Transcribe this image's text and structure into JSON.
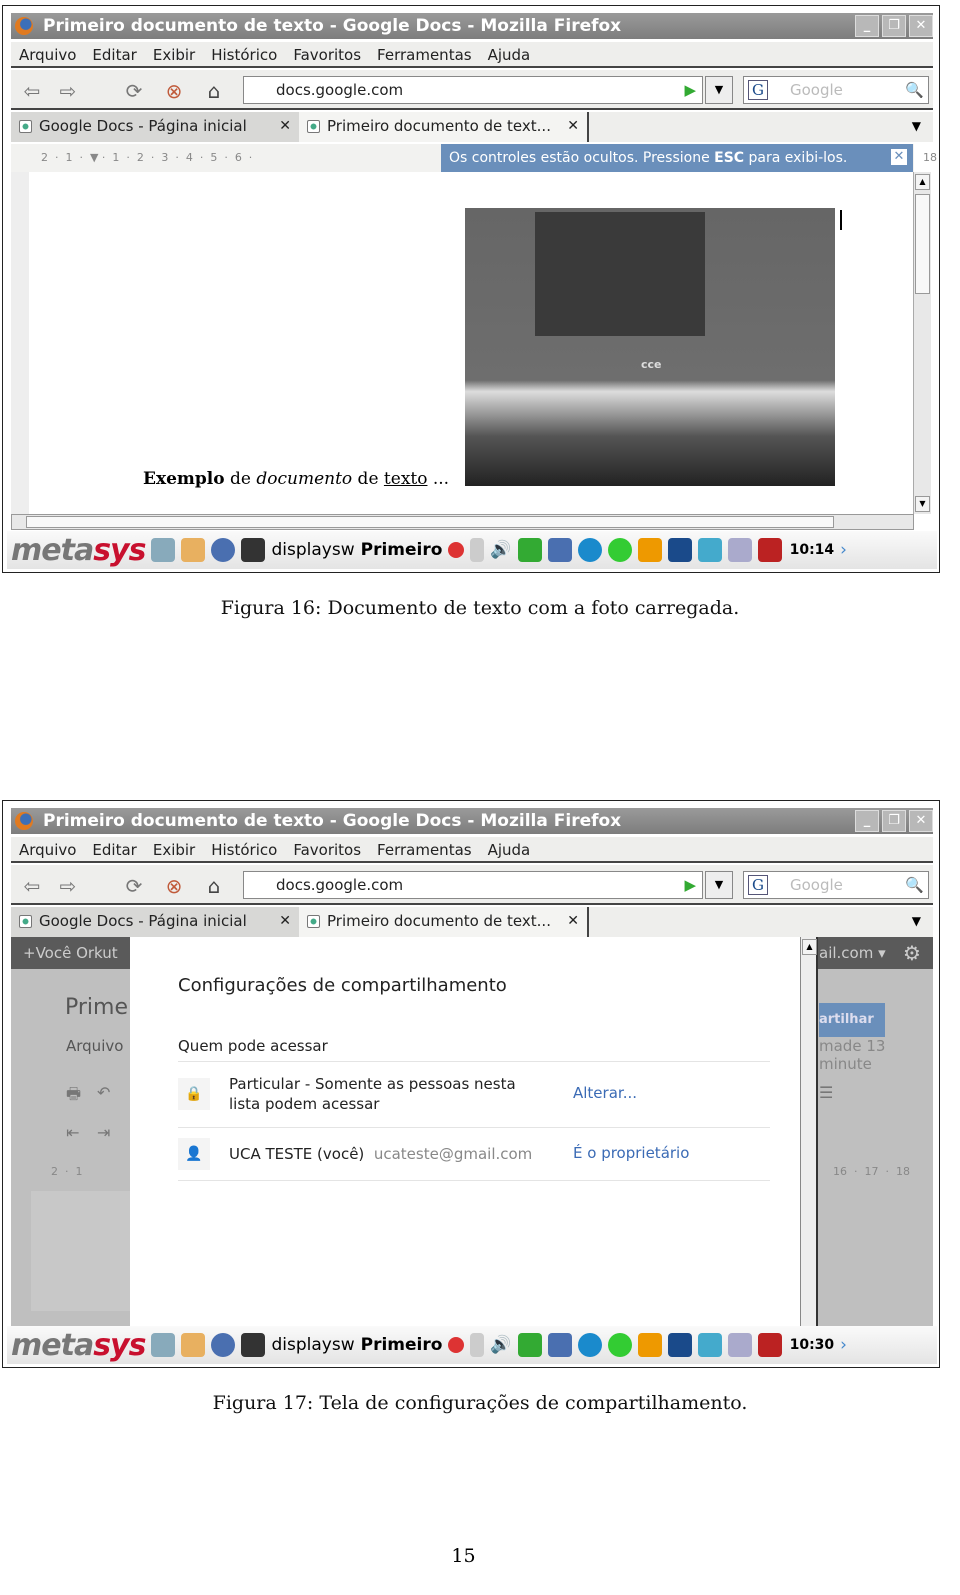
{
  "browser": {
    "window_title": "Primeiro documento de texto - Google Docs - Mozilla Firefox",
    "menu": [
      "Arquivo",
      "Editar",
      "Exibir",
      "Histórico",
      "Favoritos",
      "Ferramentas",
      "Ajuda"
    ],
    "url": "docs.google.com",
    "search_placeholder": "Google",
    "search_engine": "G",
    "tabs": [
      {
        "label": "Google Docs - Página inicial",
        "active": false
      },
      {
        "label": "Primeiro documento de text...",
        "active": true
      }
    ]
  },
  "figure16": {
    "ruler": "2  ·  1  ·  ▼ ·  1  ·  2  ·  3  ·  4  ·  5  ·  6  ·",
    "ruler_right": "18",
    "notice_prefix": "Os controles estão ocultos. Pressione ",
    "notice_key": "ESC",
    "notice_suffix": " para exibi-los.",
    "doc_text": {
      "bold": "Exemplo",
      "t1": " de ",
      "italic": "documento",
      "t2": " de ",
      "underline": "texto",
      "t3": " ..."
    },
    "photo_brand": "cce",
    "taskbar": {
      "logo_a": "meta",
      "logo_b": "sys",
      "app1": "displaysw",
      "app2": "Primeiro",
      "clock": "10:14"
    },
    "caption": "Figura 16: Documento de texto com a foto carregada."
  },
  "figure17": {
    "gbar_left": "+Você   Orkut",
    "gbar_right": "ail.com ▾",
    "doc_title": "Prime",
    "doc_menu": "Arquivo",
    "share_button": "artilhar",
    "saved_text": "made 13 minute",
    "ruler": "2  ·  1",
    "ruler_right": "16  ·  17  ·  18",
    "dialog": {
      "title": "Configurações de compartilhamento",
      "subtitle": "Quem pode acessar",
      "rows": [
        {
          "line1": "Particular - Somente as pessoas nesta",
          "line2": "lista podem acessar",
          "action": "Alterar..."
        },
        {
          "name": "UCA TESTE (você)",
          "email": "ucateste@gmail.com",
          "role": "É o proprietário"
        }
      ]
    },
    "taskbar": {
      "logo_a": "meta",
      "logo_b": "sys",
      "app1": "displaysw",
      "app2": "Primeiro",
      "clock": "10:30"
    },
    "caption": "Figura 17: Tela de configurações de compartilhamento."
  },
  "page_number": "15",
  "colors": {
    "notice": "#6a8fbb",
    "link": "#3b6bb5",
    "brand_red": "#c8102e"
  }
}
